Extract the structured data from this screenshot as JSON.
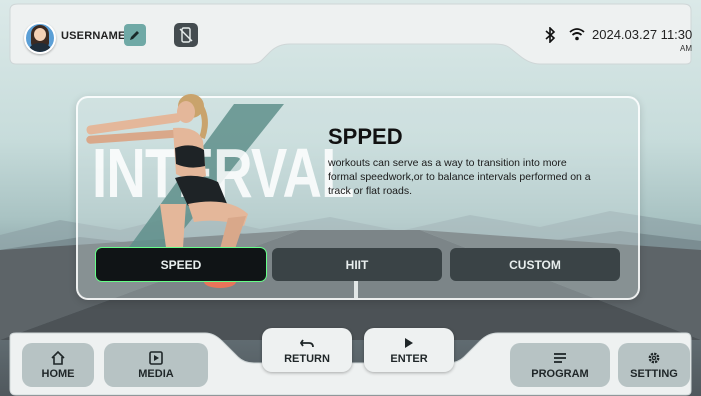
{
  "header": {
    "username": "USERNAME",
    "datetime": "2024.03.27 11:30",
    "ampm": "AM"
  },
  "hero": {
    "background_word": "INTERVAL",
    "title": "SPPED",
    "description": "workouts can serve as a way to transition into more formal speedwork,or to balance intervals performed on a track or flat roads."
  },
  "modes": [
    {
      "label": "SPEED",
      "selected": true
    },
    {
      "label": "HIIT",
      "selected": false
    },
    {
      "label": "CUSTOM",
      "selected": false
    }
  ],
  "nav": {
    "home": "HOME",
    "media": "MEDIA",
    "return": "RETURN",
    "enter": "ENTER",
    "program": "PROGRAM",
    "setting": "SETTING"
  },
  "icons": {
    "edit": "pencil-icon",
    "phone": "phone-off-icon",
    "bluetooth": "bluetooth-icon",
    "wifi": "wifi-icon",
    "home": "home-icon",
    "media": "media-icon",
    "return": "return-arrow-icon",
    "enter": "play-icon",
    "program": "list-icon",
    "setting": "gear-icon"
  },
  "colors": {
    "accent": "#6fa9a6",
    "selected_mode": "#101416",
    "mode_button": "#3a4346"
  }
}
